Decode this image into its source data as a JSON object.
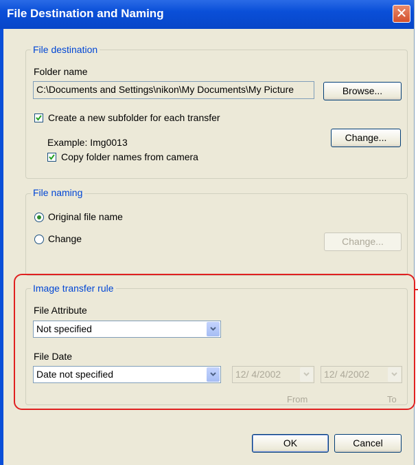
{
  "dialog": {
    "title": "File Destination and Naming",
    "close_icon": "close-icon"
  },
  "file_destination": {
    "legend": "File destination",
    "folder_label": "Folder name",
    "folder_path": "C:\\Documents and Settings\\nikon\\My Documents\\My Picture",
    "browse_label": "Browse...",
    "subfolder_label": "Create a new subfolder for each transfer",
    "subfolder_checked": true,
    "example_text": "Example: Img0013",
    "change_label": "Change...",
    "copy_names_label": "Copy folder names from camera",
    "copy_names_checked": true
  },
  "file_naming": {
    "legend": "File naming",
    "original_label": "Original file name",
    "change_option_label": "Change",
    "selected": "original",
    "change_label": "Change..."
  },
  "transfer_rule": {
    "legend": "Image transfer rule",
    "attribute_label": "File Attribute",
    "attribute_value": "Not specified",
    "date_label": "File Date",
    "date_value": "Date not specified",
    "from_date": "12/ 4/2002",
    "to_date": "12/ 4/2002",
    "from_label": "From",
    "to_label": "To"
  },
  "footer": {
    "ok_label": "OK",
    "cancel_label": "Cancel"
  },
  "colors": {
    "highlight": "#e02020",
    "legend_blue": "#0046d5"
  }
}
